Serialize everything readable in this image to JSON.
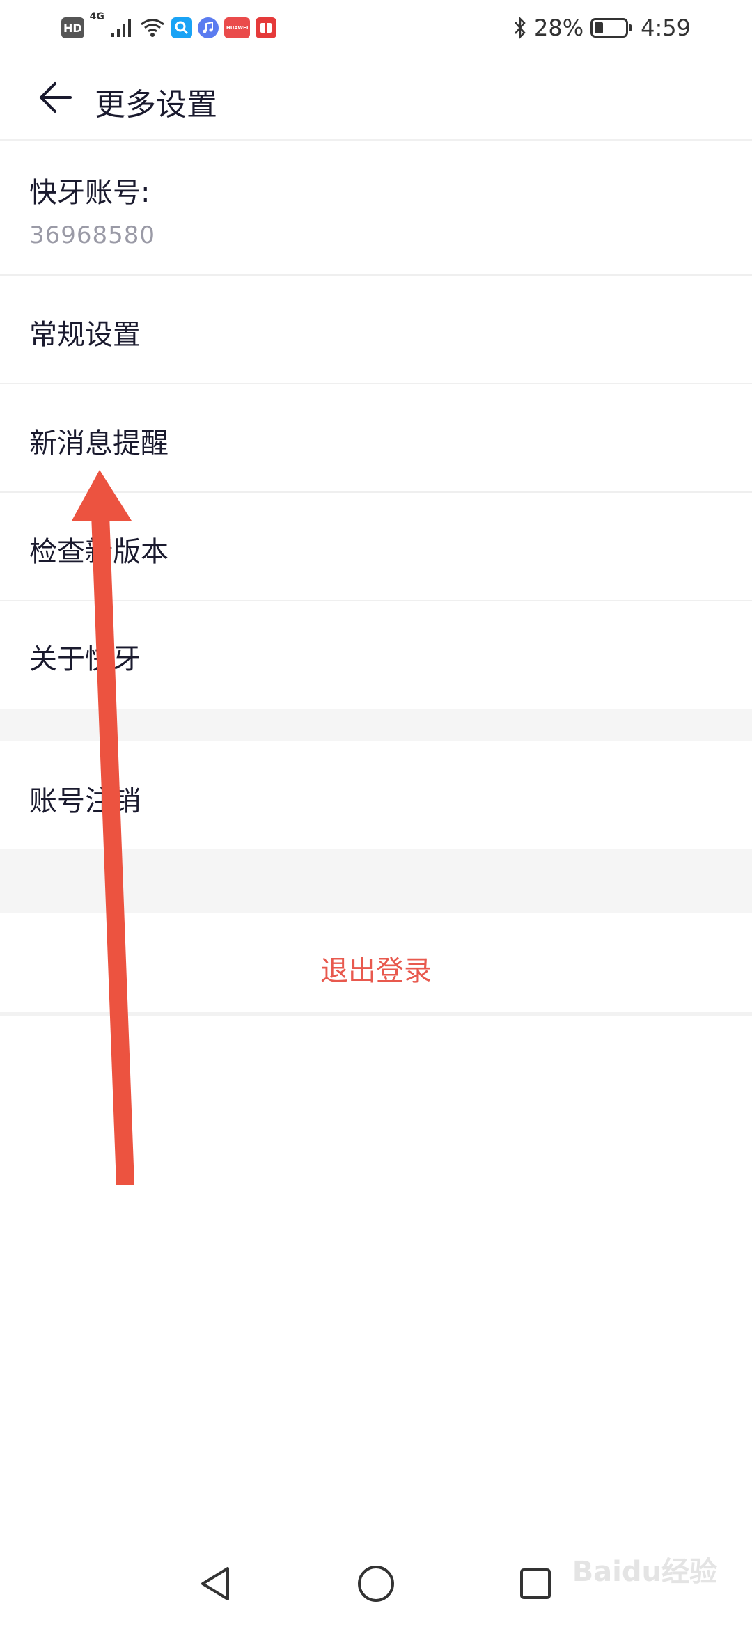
{
  "status_bar": {
    "hd": "HD",
    "network": "4G",
    "app_badges": [
      {
        "name": "search-app",
        "color": "#1aa3f5"
      },
      {
        "name": "music-app",
        "color": "#5b7cf0"
      },
      {
        "name": "huawei-app",
        "color": "#ea4b4b",
        "text": "HUAWEI"
      },
      {
        "name": "book-app",
        "color": "#e53a3a"
      }
    ],
    "battery_percent": "28%",
    "battery_level": 0.28,
    "time": "4:59"
  },
  "header": {
    "title": "更多设置",
    "back_icon": "arrow-left-icon"
  },
  "account": {
    "label": "快牙账号:",
    "value": "36968580"
  },
  "menu": [
    {
      "label": "常规设置"
    },
    {
      "label": "新消息提醒"
    },
    {
      "label": "检查新版本"
    },
    {
      "label": "关于快牙"
    }
  ],
  "account_cancel": {
    "label": "账号注销"
  },
  "logout": {
    "label": "退出登录",
    "color": "#e8594e"
  },
  "colors": {
    "accent_red": "#e8594e",
    "annotation_arrow": "#ec5340",
    "divider": "#efefef",
    "section_gap": "#f5f5f5"
  },
  "watermark": "Baidu经验"
}
